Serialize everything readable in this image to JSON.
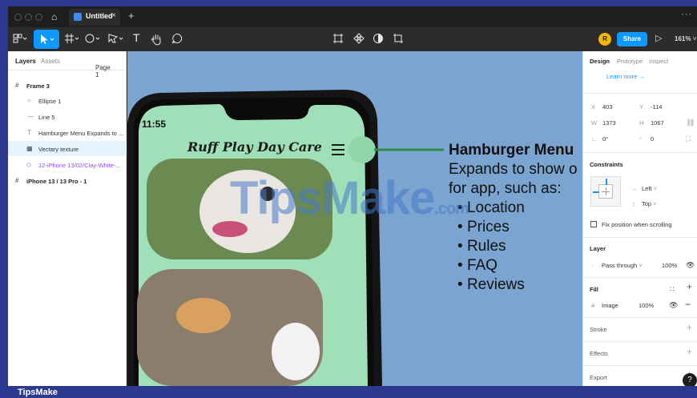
{
  "titlebar": {
    "tab_name": "Untitled",
    "tab_close": "×",
    "new_tab": "+",
    "more": "···"
  },
  "toolbar": {
    "avatar_initial": "R",
    "share_label": "Share",
    "zoom": "161%"
  },
  "left_panel": {
    "tabs": [
      "Layers",
      "Assets"
    ],
    "page": "Page 1",
    "layers": [
      {
        "name": "Frame 3"
      },
      {
        "name": "Ellipse 1"
      },
      {
        "name": "Line 5"
      },
      {
        "name": "Hamburger Menu Expands to ..."
      },
      {
        "name": "Vectary texture"
      },
      {
        "name": "12-iPhone 13/02/Clay-White-..."
      },
      {
        "name": "iPhone 13 / 13 Pro - 1"
      }
    ]
  },
  "canvas": {
    "phone_time": "11:55",
    "app_title": "Ruff Play Day Care",
    "annotation_title": "Hamburger Menu",
    "annotation_line1": "Expands to show o",
    "annotation_line2": "for app, such as:",
    "bullets": [
      "Location",
      "Prices",
      "Rules",
      "FAQ",
      "Reviews"
    ],
    "watermark": "TipsMake",
    "watermark_suffix": ".com"
  },
  "right_panel": {
    "tabs": [
      "Design",
      "Prototype",
      "Inspect"
    ],
    "learn_more": "Learn more →",
    "x_label": "X",
    "x_value": "403",
    "y_label": "Y",
    "y_value": "-114",
    "w_label": "W",
    "w_value": "1373",
    "h_label": "H",
    "h_value": "1067",
    "rotation": "0°",
    "radius": "0",
    "constraints_title": "Constraints",
    "constraint_h": "Left",
    "constraint_v": "Top",
    "fix_position": "Fix position when scrolling",
    "layer_title": "Layer",
    "blend": "Pass through",
    "layer_opacity": "100%",
    "fill_title": "Fill",
    "fill_type": "Image",
    "fill_opacity": "100%",
    "stroke_title": "Stroke",
    "effects_title": "Effects",
    "export_title": "Export",
    "help": "?"
  },
  "footer": {
    "brand": "TipsMake"
  },
  "colors": {
    "accent": "#0d99ff",
    "canvas": "#7ba4d0",
    "app_green": "#9fe0b8",
    "avatar": "#f5b800"
  }
}
